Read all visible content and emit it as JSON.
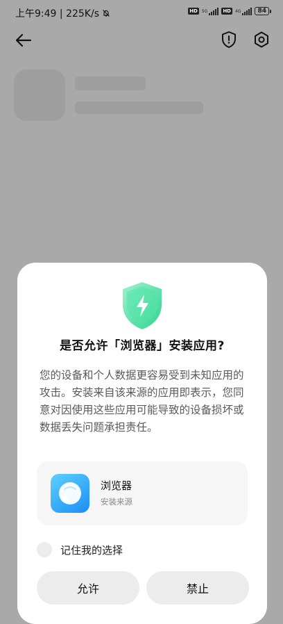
{
  "status_bar": {
    "time": "上午9:49",
    "speed": "225K/s",
    "net1": "5G",
    "net2": "4G",
    "hd": "HD",
    "battery": "84"
  },
  "dialog": {
    "title": "是否允许「浏览器」安装应用?",
    "body": "您的设备和个人数据更容易受到未知应用的攻击。安装来自该来源的应用即表示，您同意对因使用这些应用可能导致的设备损坏或数据丢失问题承担责任。",
    "app_name": "浏览器",
    "app_source": "安装来源",
    "remember_label": "记住我的选择",
    "allow_label": "允许",
    "deny_label": "禁止"
  },
  "icons": {
    "back": "arrow-left-icon",
    "shield": "shield-alert-icon",
    "settings": "settings-icon",
    "status_mute": "bell-off-icon",
    "dialog_shield": "shield-bolt-icon"
  },
  "colors": {
    "scrim": "#a9a9a9",
    "dialog_bg": "#ffffff",
    "shield_green": "#3ddc9a",
    "app_blue": "#2a9cf7"
  }
}
